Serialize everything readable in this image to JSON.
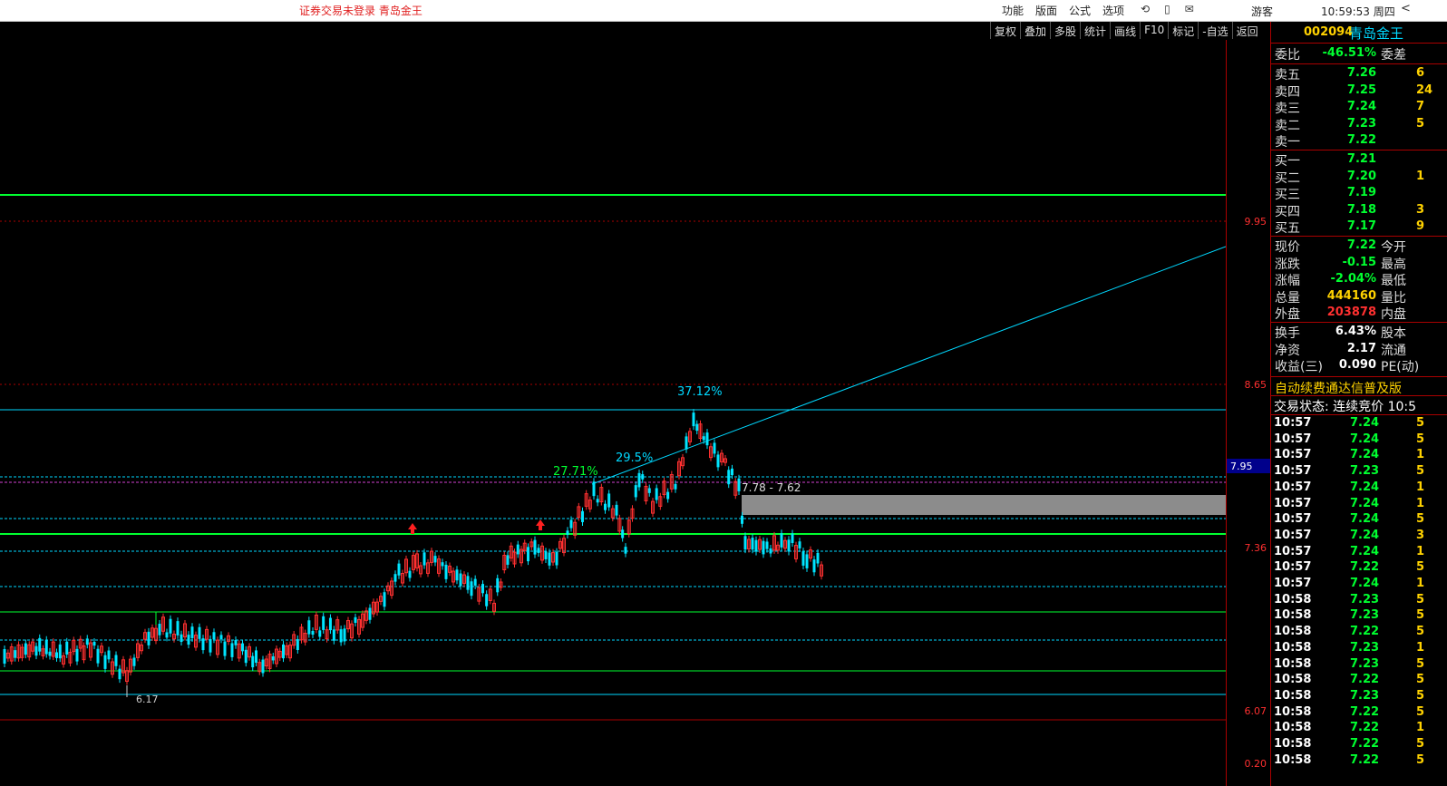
{
  "topbar": {
    "login_status": "证券交易未登录  青岛金王",
    "menu": [
      "功能",
      "版面",
      "公式",
      "选项"
    ],
    "icons": [
      "refresh-icon",
      "phone-icon",
      "mail-icon"
    ],
    "guest": "游客",
    "clock": "10:59:53 周四",
    "window_control": "<"
  },
  "toolbar": [
    "复权",
    "叠加",
    "多股",
    "统计",
    "画线",
    "F10",
    "标记",
    "-自选",
    "返回"
  ],
  "chart": {
    "price_axis": {
      "labels": [
        "9.95",
        "8.65",
        "7.36",
        "6.07",
        "0.20"
      ],
      "current_price_tag": "7.95"
    },
    "annotations": {
      "pct_1": "27.71%",
      "pct_2": "29.5%",
      "pct_3": "37.12%",
      "range": "7.78 - 7.62",
      "low_marker": "6.17"
    },
    "colors": {
      "up": "#ff3030",
      "down": "#00e5ff",
      "green_line": "#00ff30",
      "cyan_line": "#00d8ff",
      "gap_box": "#8c8c8c"
    }
  },
  "quote": {
    "code": "002094",
    "name": "青岛金王",
    "ratio": {
      "label": "委比",
      "value": "-46.51%",
      "label2": "委差"
    },
    "asks": [
      {
        "label": "卖五",
        "price": "7.26",
        "vol": "6"
      },
      {
        "label": "卖四",
        "price": "7.25",
        "vol": "24"
      },
      {
        "label": "卖三",
        "price": "7.24",
        "vol": "7"
      },
      {
        "label": "卖二",
        "price": "7.23",
        "vol": "5"
      },
      {
        "label": "卖一",
        "price": "7.22",
        "vol": ""
      }
    ],
    "bids": [
      {
        "label": "买一",
        "price": "7.21",
        "vol": ""
      },
      {
        "label": "买二",
        "price": "7.20",
        "vol": "1"
      },
      {
        "label": "买三",
        "price": "7.19",
        "vol": ""
      },
      {
        "label": "买四",
        "price": "7.18",
        "vol": "3"
      },
      {
        "label": "买五",
        "price": "7.17",
        "vol": "9"
      }
    ],
    "stats1": [
      {
        "label": "现价",
        "value": "7.22",
        "label2": "今开",
        "color": "green"
      },
      {
        "label": "涨跌",
        "value": "-0.15",
        "label2": "最高",
        "color": "green"
      },
      {
        "label": "涨幅",
        "value": "-2.04%",
        "label2": "最低",
        "color": "green"
      },
      {
        "label": "总量",
        "value": "444160",
        "label2": "量比",
        "color": "yellow"
      },
      {
        "label": "外盘",
        "value": "203878",
        "label2": "内盘",
        "color": "red"
      }
    ],
    "stats2": [
      {
        "label": "换手",
        "value": "6.43%",
        "label2": "股本",
        "color": "white"
      },
      {
        "label": "净资",
        "value": "2.17",
        "label2": "流通",
        "color": "white"
      },
      {
        "label": "收益(三)",
        "value": "0.090",
        "label2": "PE(动)",
        "color": "white"
      }
    ],
    "notice": "自动续费通达信普及版",
    "trade_state": "交易状态: 连续竞价 10:5",
    "ticks": [
      {
        "time": "10:57",
        "price": "7.24",
        "vol": "5"
      },
      {
        "time": "10:57",
        "price": "7.24",
        "vol": "5"
      },
      {
        "time": "10:57",
        "price": "7.24",
        "vol": "1"
      },
      {
        "time": "10:57",
        "price": "7.23",
        "vol": "5"
      },
      {
        "time": "10:57",
        "price": "7.24",
        "vol": "1"
      },
      {
        "time": "10:57",
        "price": "7.24",
        "vol": "1"
      },
      {
        "time": "10:57",
        "price": "7.24",
        "vol": "5"
      },
      {
        "time": "10:57",
        "price": "7.24",
        "vol": "3"
      },
      {
        "time": "10:57",
        "price": "7.24",
        "vol": "1"
      },
      {
        "time": "10:57",
        "price": "7.22",
        "vol": "5"
      },
      {
        "time": "10:57",
        "price": "7.24",
        "vol": "1"
      },
      {
        "time": "10:58",
        "price": "7.23",
        "vol": "5"
      },
      {
        "time": "10:58",
        "price": "7.23",
        "vol": "5"
      },
      {
        "time": "10:58",
        "price": "7.22",
        "vol": "5"
      },
      {
        "time": "10:58",
        "price": "7.23",
        "vol": "1"
      },
      {
        "time": "10:58",
        "price": "7.23",
        "vol": "5"
      },
      {
        "time": "10:58",
        "price": "7.22",
        "vol": "5"
      },
      {
        "time": "10:58",
        "price": "7.23",
        "vol": "5"
      },
      {
        "time": "10:58",
        "price": "7.22",
        "vol": "5"
      },
      {
        "time": "10:58",
        "price": "7.22",
        "vol": "1"
      },
      {
        "time": "10:58",
        "price": "7.22",
        "vol": "5"
      },
      {
        "time": "10:58",
        "price": "7.22",
        "vol": "5"
      }
    ]
  }
}
